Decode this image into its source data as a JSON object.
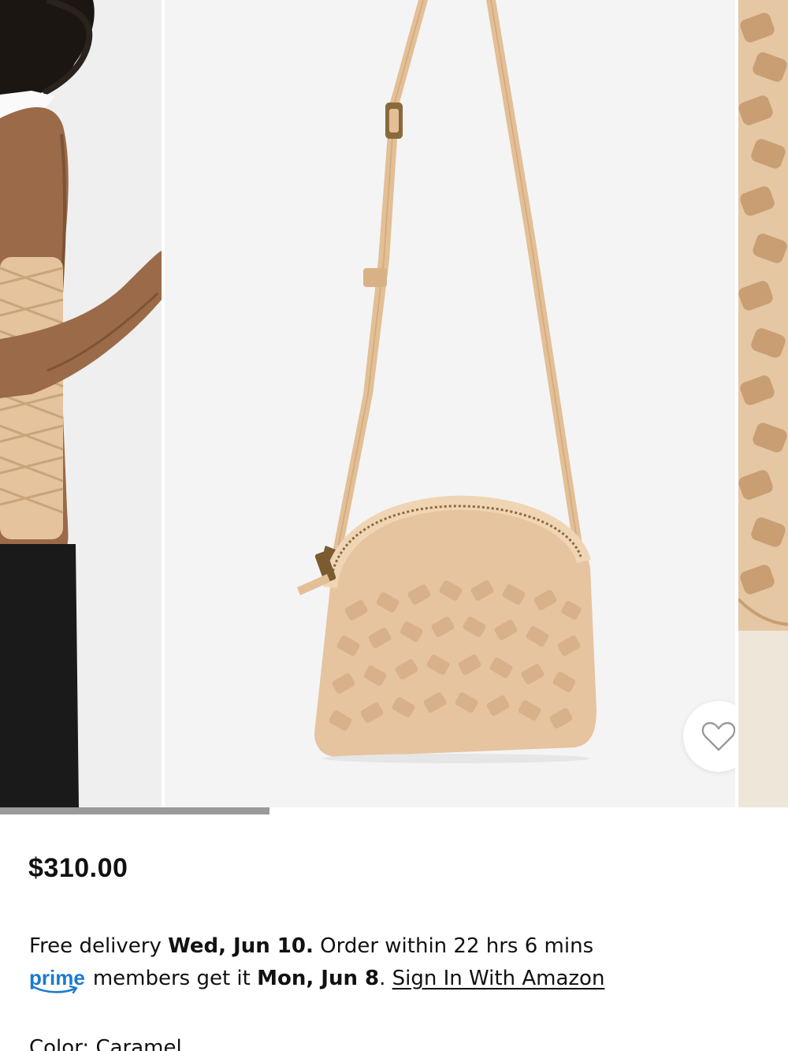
{
  "gallery": {
    "slides": [
      "model-wearing-bag",
      "bag-hanging",
      "bag-detail-closeup"
    ],
    "favorite_icon": "heart-icon",
    "scroll_progress": 0.342
  },
  "product": {
    "price": "$310.00",
    "delivery": {
      "free_prefix": "Free delivery",
      "date": "Wed, Jun 10.",
      "order_within": "Order within 22 hrs 6 mins",
      "prime_logo": "prime",
      "prime_text": "members get it",
      "prime_date": "Mon, Jun 8",
      "prime_suffix": ".",
      "signin_link": "Sign In With Amazon"
    },
    "color_label": "Color: Caramel"
  },
  "colors": {
    "prime_blue": "#1a7bd1",
    "leather": "#e6c49f",
    "progress": "#9a9a9a"
  }
}
